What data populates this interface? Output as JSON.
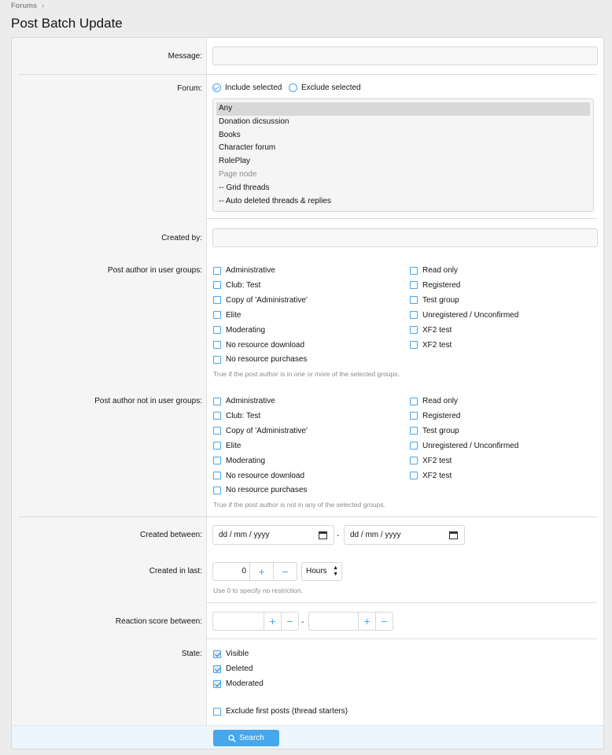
{
  "breadcrumb": {
    "item": "Forums",
    "separator": "›"
  },
  "page": {
    "title": "Post Batch Update"
  },
  "labels": {
    "message": "Message:",
    "forum": "Forum:",
    "created_by": "Created by:",
    "author_in": "Post author in user groups:",
    "author_not_in": "Post author not in user groups:",
    "created_between": "Created between:",
    "created_last": "Created in last:",
    "reaction": "Reaction score between:",
    "state": "State:"
  },
  "forum_mode": {
    "include": "Include selected",
    "exclude": "Exclude selected",
    "selected": "include"
  },
  "forums": [
    {
      "label": "Any",
      "selected": true
    },
    {
      "label": "Donation dicsussion"
    },
    {
      "label": "Books"
    },
    {
      "label": "Character forum"
    },
    {
      "label": "RolePlay"
    },
    {
      "label": "Page node",
      "muted": true
    },
    {
      "label": "-- Grid threads"
    },
    {
      "label": "-- Auto deleted threads & replies"
    }
  ],
  "groups_left": [
    "Administrative",
    "Club: Test",
    "Copy of 'Administrative'",
    "Elite",
    "Moderating",
    "No resource download",
    "No resource purchases"
  ],
  "groups_right": [
    "Read only",
    "Registered",
    "Test group",
    "Unregistered / Unconfirmed",
    "XF2 test",
    "XF2 test"
  ],
  "hints": {
    "in": "True if the post author is in one or more of the selected groups.",
    "not_in": "True if the post author is not in any of the selected groups.",
    "zero": "Use 0 to specify no restriction."
  },
  "dates": {
    "placeholder": "dd / mm / yyyy",
    "dash": "-"
  },
  "created_last": {
    "value": "0",
    "unit": "Hours",
    "plus": "+",
    "minus": "−"
  },
  "reaction": {
    "dash": "-",
    "plus": "+",
    "minus": "−"
  },
  "states": [
    {
      "label": "Visible",
      "checked": true
    },
    {
      "label": "Deleted",
      "checked": true
    },
    {
      "label": "Moderated",
      "checked": true
    }
  ],
  "exclude_first": "Exclude first posts (thread starters)",
  "search": {
    "label": "Search"
  },
  "colors": {
    "accent": "#47a7eb"
  }
}
